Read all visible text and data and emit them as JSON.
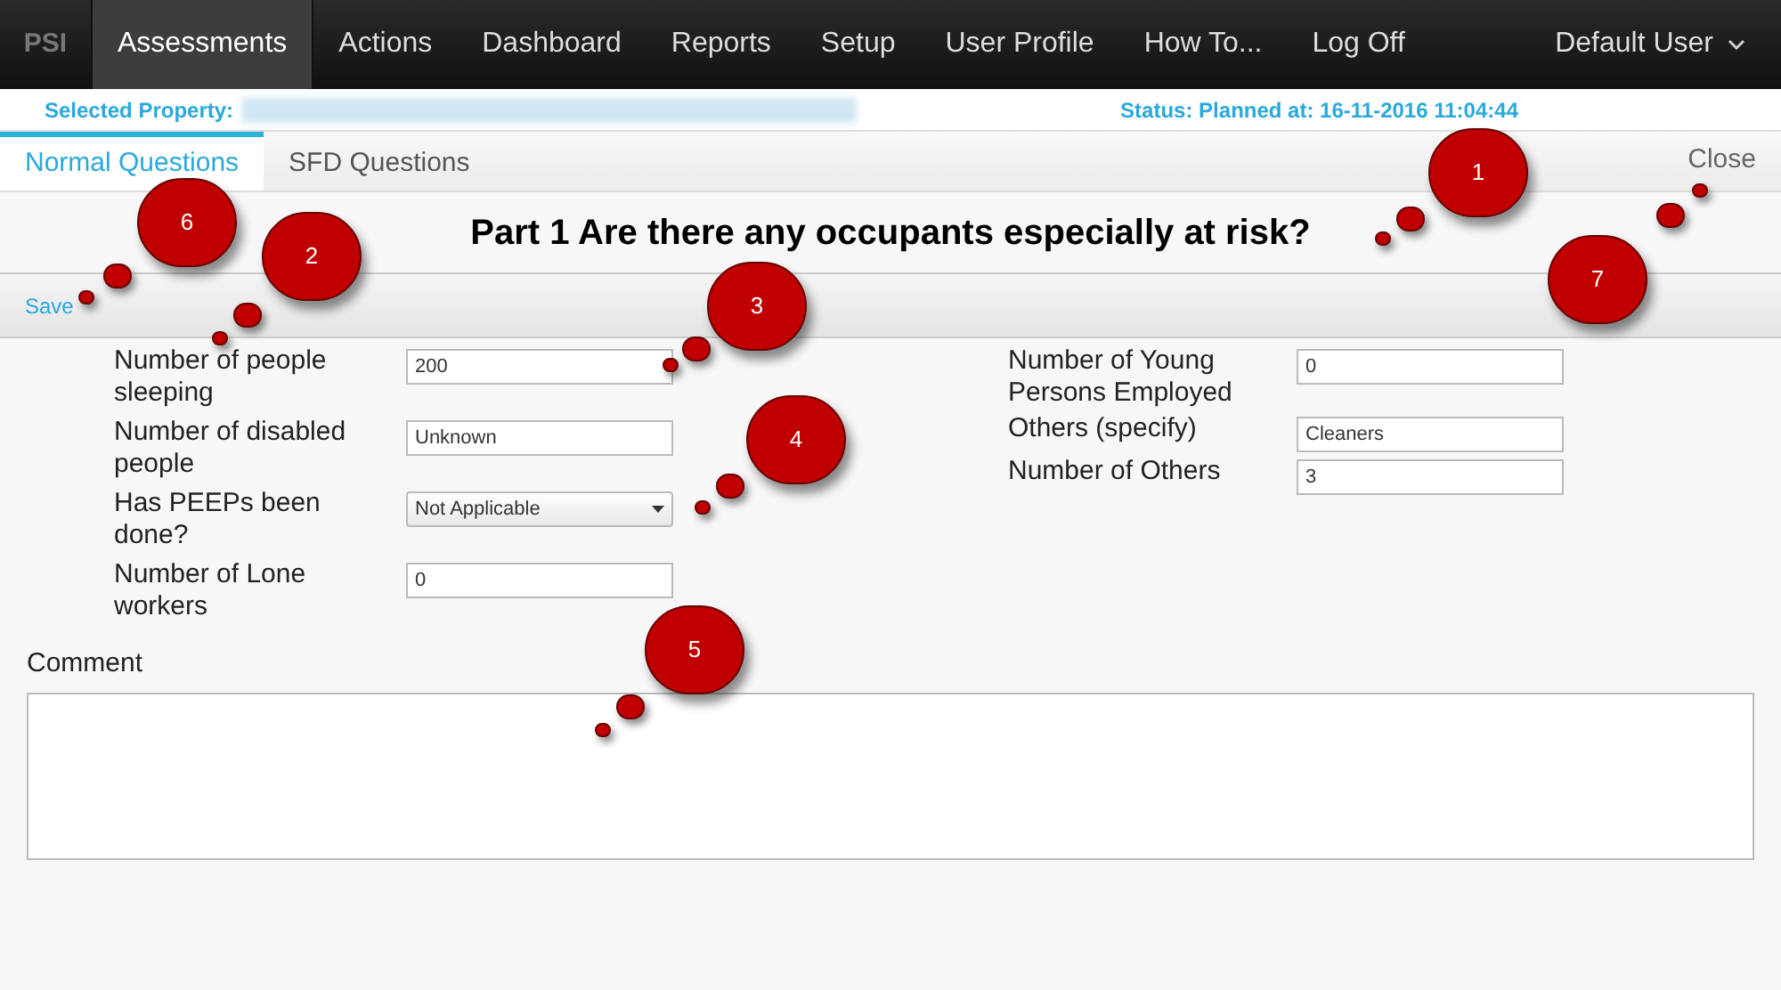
{
  "nav": {
    "logo": "PSI",
    "items": [
      {
        "label": "Assessments",
        "selected": true
      },
      {
        "label": "Actions",
        "selected": false
      },
      {
        "label": "Dashboard",
        "selected": false
      },
      {
        "label": "Reports",
        "selected": false
      },
      {
        "label": "Setup",
        "selected": false
      },
      {
        "label": "User Profile",
        "selected": false
      },
      {
        "label": "How To...",
        "selected": false
      },
      {
        "label": "Log Off",
        "selected": false
      }
    ],
    "user": "Default User"
  },
  "info_bar": {
    "property_label": "Selected Property:",
    "status": "Status: Planned at: 16-11-2016 11:04:44"
  },
  "tabs": [
    {
      "label": "Normal Questions",
      "selected": true
    },
    {
      "label": "SFD Questions",
      "selected": false
    }
  ],
  "close": "Close",
  "title": "Part 1 Are there any occupants especially at risk?",
  "toolbar": {
    "save": "Save"
  },
  "left_fields": [
    {
      "kind": "text",
      "label": "Number of people sleeping",
      "value": "200"
    },
    {
      "kind": "text",
      "label": "Number of disabled people",
      "value": "Unknown"
    },
    {
      "kind": "select",
      "label": "Has PEEPs been done?",
      "value": "Not Applicable"
    },
    {
      "kind": "text",
      "label": "Number of Lone workers",
      "value": "0"
    }
  ],
  "right_fields": [
    {
      "kind": "text",
      "label": "Number of Young Persons Employed",
      "value": "0"
    },
    {
      "kind": "text",
      "label": "Others (specify)",
      "value": "Cleaners"
    },
    {
      "kind": "text",
      "label": "Number of Others",
      "value": "3"
    }
  ],
  "comment_label": "Comment",
  "callouts": [
    {
      "number": "1"
    },
    {
      "number": "2"
    },
    {
      "number": "3"
    },
    {
      "number": "4"
    },
    {
      "number": "5"
    },
    {
      "number": "6"
    },
    {
      "number": "7"
    }
  ]
}
